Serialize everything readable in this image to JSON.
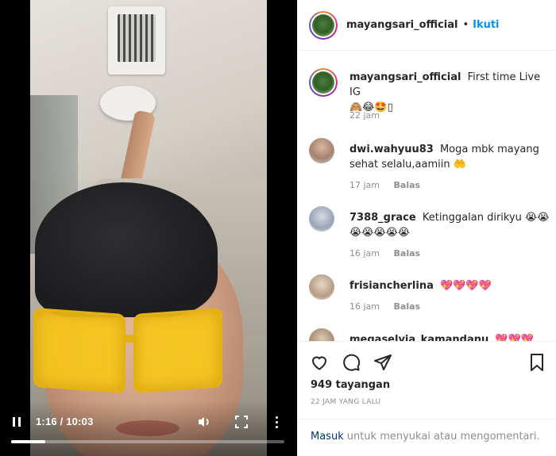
{
  "video": {
    "time_display": "1:16 / 10:03",
    "progress_fraction": 0.126
  },
  "post": {
    "username": "mayangsari_official",
    "dot": "•",
    "follow_label": "Ikuti"
  },
  "comments": [
    {
      "user": "mayangsari_official",
      "text": "First time Live IG",
      "emoji": "🙈😂🤩▯",
      "time": "22 jam",
      "reply": ""
    },
    {
      "user": "dwi.wahyuu83",
      "text": "Moga mbk mayang sehat selalu,aamiin 🤲",
      "emoji": "",
      "time": "17 jam",
      "reply": "Balas"
    },
    {
      "user": "7388_grace",
      "text": "Ketinggalan dirikyu 😭😭",
      "emoji": "😭😭😭😭😭",
      "time": "16 jam",
      "reply": "Balas"
    },
    {
      "user": "frisiancherlina",
      "text": "💖💖💖💖",
      "emoji": "",
      "time": "16 jam",
      "reply": "Balas"
    },
    {
      "user": "megaselvia_kamandanu",
      "text": "💖💖💖",
      "emoji": "",
      "time": "",
      "reply": ""
    }
  ],
  "actions": {
    "views": "949 tayangan",
    "posted": "22 JAM YANG LALU"
  },
  "login": {
    "link": "Masuk",
    "text": "untuk menyukai atau mengomentari."
  },
  "colors": {
    "link_blue": "#0095f6",
    "login_blue": "#00376b",
    "muted": "#8e8e8e",
    "text": "#262626"
  },
  "icons": [
    "pause-icon",
    "volume-icon",
    "fullscreen-icon",
    "more-icon",
    "heart-icon",
    "comment-icon",
    "share-icon",
    "bookmark-icon"
  ]
}
